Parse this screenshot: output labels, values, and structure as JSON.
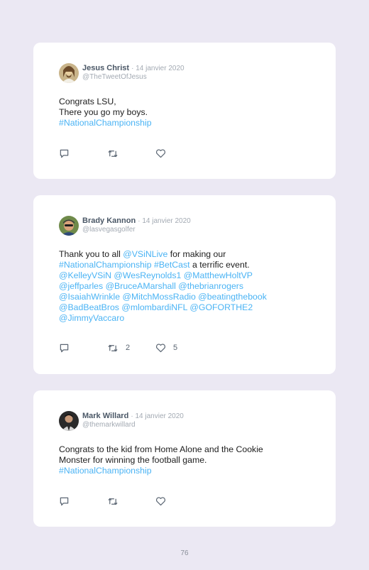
{
  "colors": {
    "background": "#ebe8f3",
    "card": "#ffffff",
    "link": "#4ab3f4",
    "name": "#4a5766",
    "meta": "#a3aab3"
  },
  "icons": {
    "reply": "comment-bubble-icon",
    "retweet": "retweet-icon",
    "like": "heart-icon"
  },
  "tweets": [
    {
      "name": "Jesus Christ",
      "date": "· 14 janvier 2020",
      "handle": "@TheTweetOfJesus",
      "lines": [
        {
          "parts": [
            {
              "text": "Congrats LSU,",
              "link": false
            }
          ]
        },
        {
          "parts": [
            {
              "text": "There you go my boys.",
              "link": false
            }
          ]
        },
        {
          "parts": [
            {
              "text": "#NationalChampionship",
              "link": true
            }
          ]
        }
      ],
      "retweets": "",
      "likes": ""
    },
    {
      "name": "Brady Kannon",
      "date": "· 14 janvier 2020",
      "handle": "@lasvegasgolfer",
      "lines": [
        {
          "parts": [
            {
              "text": "Thank you to all ",
              "link": false
            },
            {
              "text": "@VSiNLive",
              "link": true
            },
            {
              "text": " for making our",
              "link": false
            }
          ]
        },
        {
          "parts": [
            {
              "text": "#NationalChampionship",
              "link": true
            },
            {
              "text": " ",
              "link": false
            },
            {
              "text": "#BetCast",
              "link": true
            },
            {
              "text": " a terrific event.",
              "link": false
            }
          ]
        },
        {
          "parts": [
            {
              "text": "@KelleyVSiN @WesReynolds1 @MatthewHoltVP",
              "link": true
            }
          ]
        },
        {
          "parts": [
            {
              "text": "@jeffparles @BruceAMarshall @thebrianrogers",
              "link": true
            }
          ]
        },
        {
          "parts": [
            {
              "text": "@IsaiahWrinkle @MitchMossRadio @beatingthebook",
              "link": true
            }
          ]
        },
        {
          "parts": [
            {
              "text": "@BadBeatBros @mlombardiNFL @GOFORTHE2",
              "link": true
            }
          ]
        },
        {
          "parts": [
            {
              "text": "@JimmyVaccaro",
              "link": true
            }
          ]
        }
      ],
      "retweets": "2",
      "likes": "5"
    },
    {
      "name": "Mark Willard",
      "date": "· 14 janvier 2020",
      "handle": "@themarkwillard",
      "lines": [
        {
          "parts": [
            {
              "text": "Congrats to the kid from Home Alone and the Cookie",
              "link": false
            }
          ]
        },
        {
          "parts": [
            {
              "text": "Monster for winning the football game.",
              "link": false
            }
          ]
        },
        {
          "parts": [
            {
              "text": "#NationalChampionship",
              "link": true
            }
          ]
        }
      ],
      "retweets": "",
      "likes": ""
    }
  ],
  "page_number": "76"
}
